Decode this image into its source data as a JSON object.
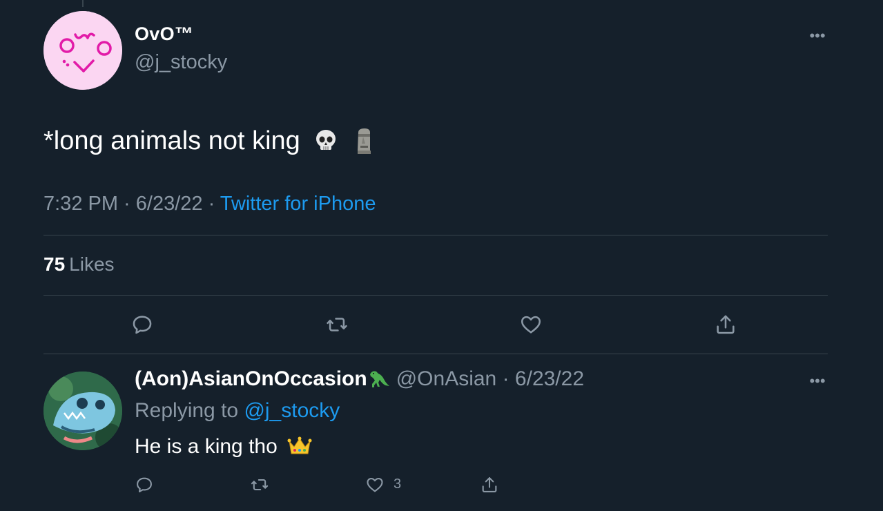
{
  "tweet": {
    "author_name": "OvO™",
    "author_handle": "@j_stocky",
    "text": "*long animals not king",
    "emojis": [
      "skull-emoji",
      "moai-emoji"
    ],
    "time": "7:32 PM",
    "date": "6/23/22",
    "source": "Twitter for iPhone",
    "likes_count": "75",
    "likes_label": "Likes",
    "avatar_text": "OwO"
  },
  "reply": {
    "author_name": "(Aon)AsianOnOccasion",
    "author_handle": "@OnAsian",
    "date": "6/23/22",
    "replying_label": "Replying to",
    "replying_to": "@j_stocky",
    "text": "He is a king tho",
    "emoji": "crown-emoji",
    "like_count": "3"
  },
  "icons": {
    "reply": "reply-icon",
    "retweet": "retweet-icon",
    "like": "heart-icon",
    "share": "share-icon",
    "more": "more-icon"
  },
  "colors": {
    "background": "#15202b",
    "text": "#ffffff",
    "secondary": "#8b98a5",
    "link": "#1d9bf0",
    "divider": "#38444d",
    "avatar_pink": "#fbd6f2",
    "avatar_accent": "#e21ba8"
  }
}
